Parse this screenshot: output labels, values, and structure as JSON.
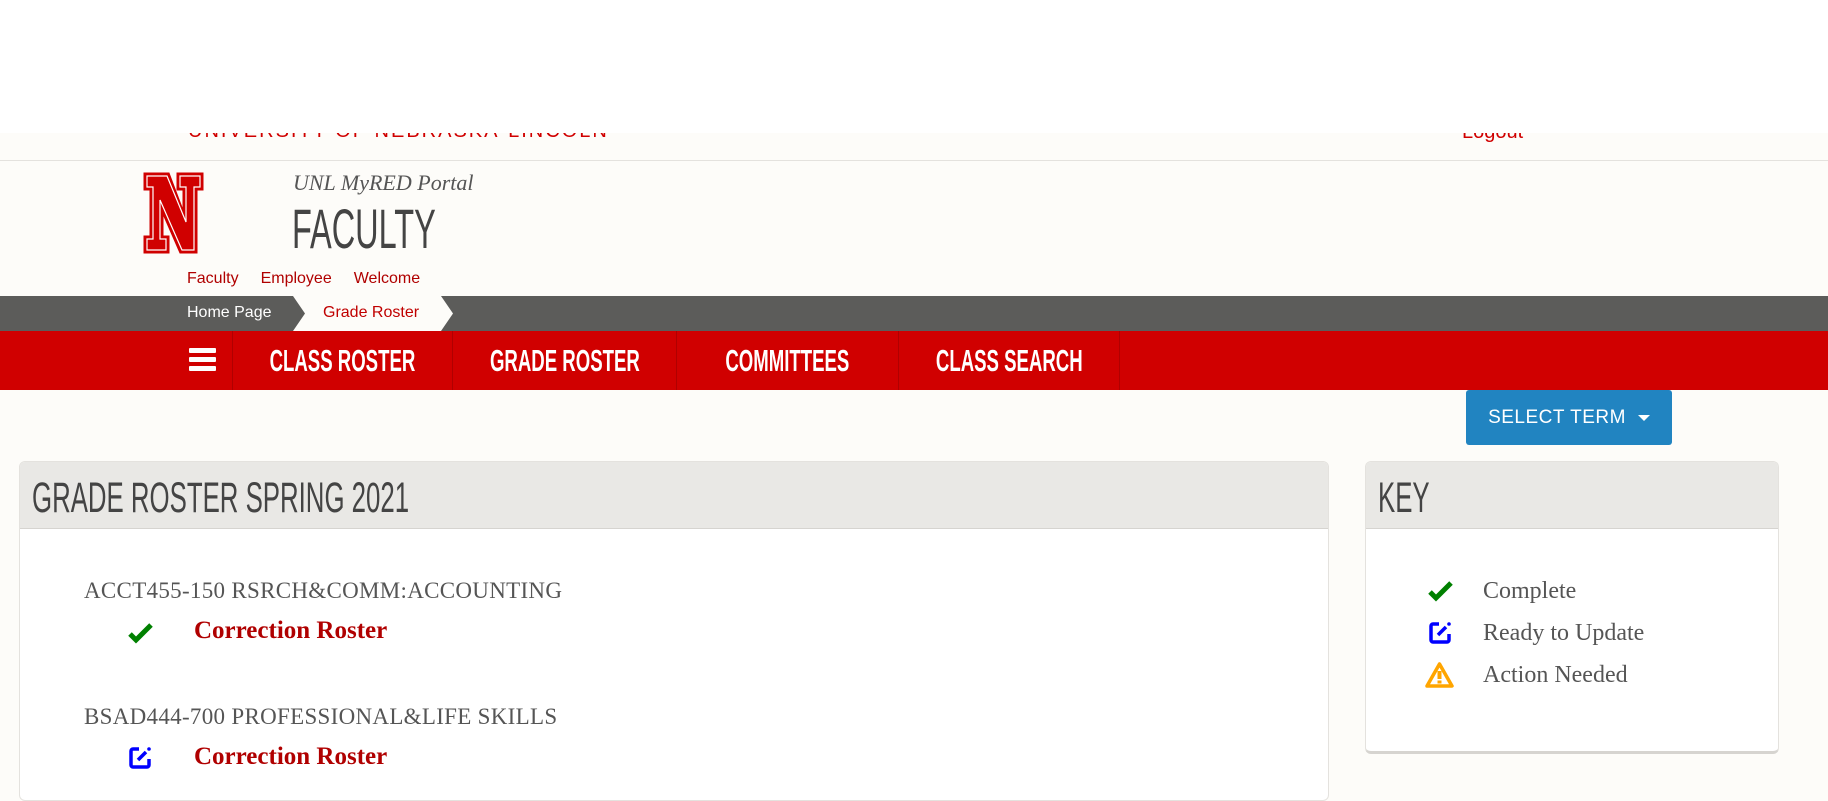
{
  "header": {
    "university": "UNIVERSITY OF NEBRASKA-LINCOLN",
    "logout": "Logout",
    "portal": "UNL MyRED Portal",
    "title": "FACULTY"
  },
  "links": [
    "Faculty",
    "Employee",
    "Welcome"
  ],
  "breadcrumb": [
    "Home Page",
    "Grade Roster"
  ],
  "nav": {
    "menu_icon": "hamburger-icon",
    "items": [
      "CLASS ROSTER",
      "GRADE ROSTER",
      "COMMITTEES",
      "CLASS SEARCH"
    ]
  },
  "select_term": "SELECT TERM",
  "main": {
    "title": "GRADE ROSTER SPRING 2021",
    "courses": [
      {
        "name": "ACCT455-150 RSRCH&COMM:ACCOUNTING",
        "status_icon": "check-icon",
        "link": "Correction Roster"
      },
      {
        "name": "BSAD444-700 PROFESSIONAL&LIFE SKILLS",
        "status_icon": "edit-icon",
        "link": "Correction Roster"
      }
    ]
  },
  "key": {
    "title": "KEY",
    "items": [
      {
        "icon": "check-icon",
        "label": "Complete"
      },
      {
        "icon": "edit-icon",
        "label": "Ready to Update"
      },
      {
        "icon": "warning-icon",
        "label": "Action Needed"
      }
    ]
  },
  "colors": {
    "brand_red": "#d00000",
    "button_blue": "#2184c1",
    "complete": "#008000",
    "ready": "#0000ff",
    "action": "#ffa500"
  }
}
